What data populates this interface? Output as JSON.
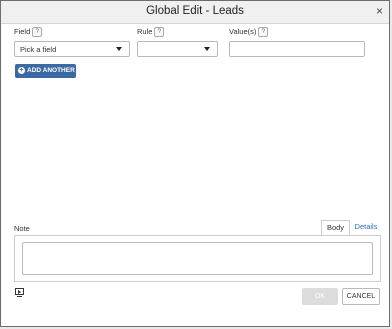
{
  "dialog": {
    "title": "Global Edit - Leads",
    "close_glyph": "×"
  },
  "filters": {
    "field_label": "Field",
    "field_value": "Pick a field",
    "rule_label": "Rule",
    "rule_value": "",
    "values_label": "Value(s)",
    "values_value": "",
    "help_glyph": "?",
    "add_another_label": "ADD ANOTHER",
    "add_icon_glyph": "+"
  },
  "note": {
    "label": "Note",
    "tab_body": "Body",
    "tab_details": "Details",
    "value": ""
  },
  "footer": {
    "ok_label": "OK",
    "cancel_label": "CANCEL",
    "screen_icon": "screen-play-icon"
  },
  "colors": {
    "primary_button": "#3b6aa3",
    "link_tab": "#2f6fb3",
    "disabled_button": "#dcdcdc"
  }
}
